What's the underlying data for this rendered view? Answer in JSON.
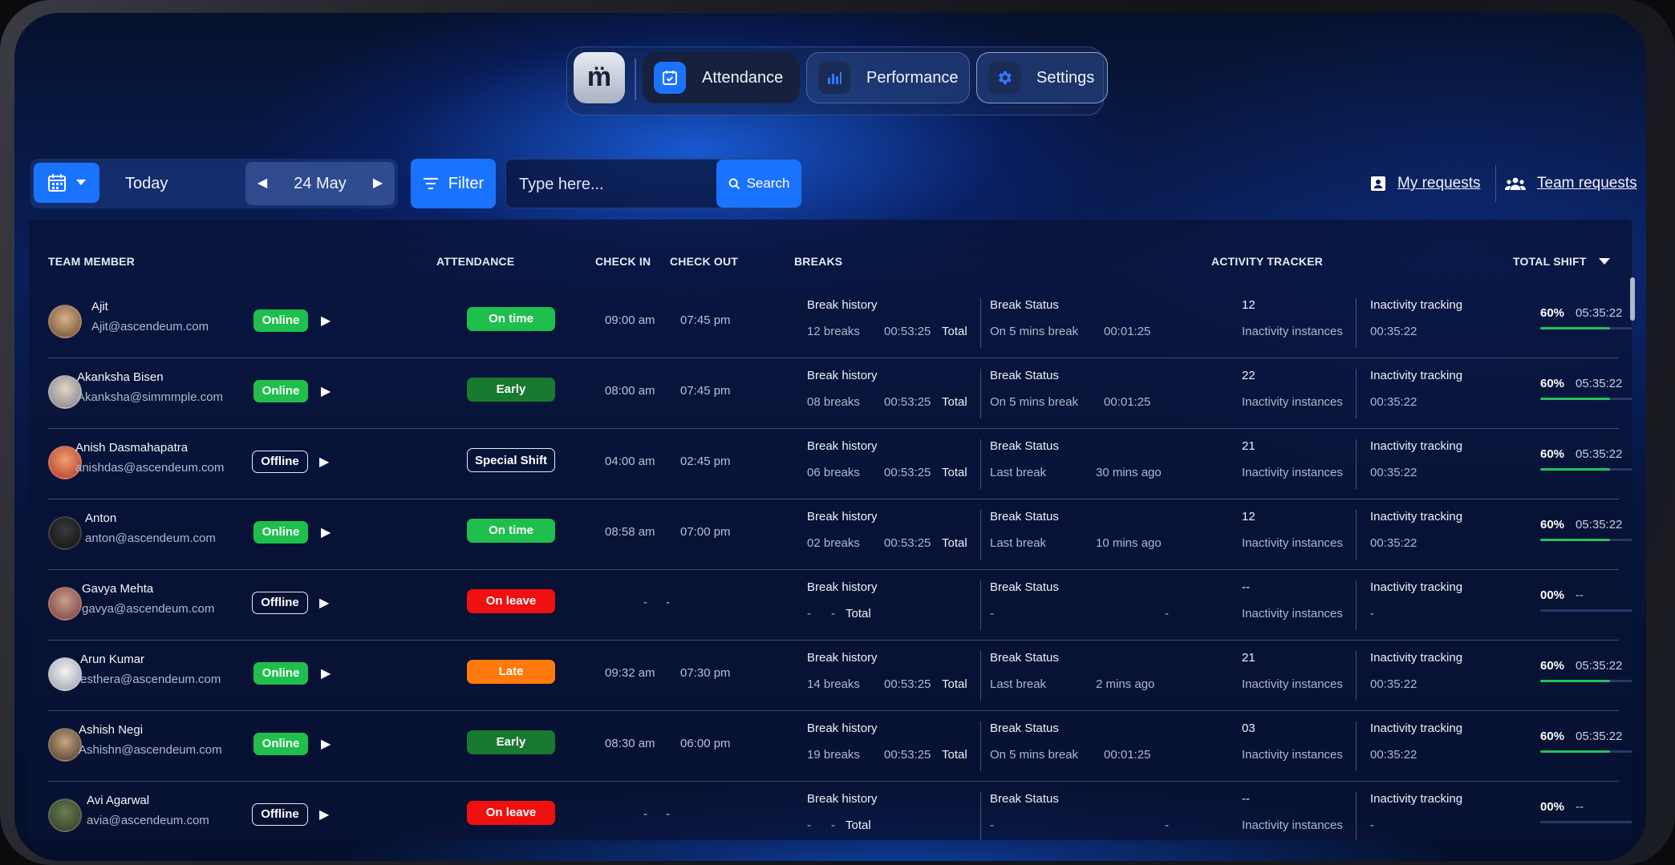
{
  "nav": {
    "logo_text": "m̈",
    "tabs": [
      {
        "label": "Attendance",
        "icon": "calendar-check-icon",
        "active": true
      },
      {
        "label": "Performance",
        "icon": "bar-chart-icon",
        "active": false
      },
      {
        "label": "Settings",
        "icon": "gear-icon",
        "active": false
      }
    ]
  },
  "toolbar": {
    "today_label": "Today",
    "date": "24 May",
    "filter_label": "Filter",
    "search_placeholder": "Type here...",
    "search_button": "Search",
    "my_requests": "My requests",
    "team_requests": "Team requests"
  },
  "table": {
    "headers": {
      "member": "TEAM MEMBER",
      "attendance": "ATTENDANCE",
      "check_in": "CHECK IN",
      "check_out": "CHECK OUT",
      "breaks": "BREAKS",
      "activity": "ACTIVITY TRACKER",
      "total_shift": "TOTAL SHIFT"
    },
    "labels": {
      "break_history": "Break history",
      "break_status": "Break Status",
      "inactivity_instances": "Inactivity instances",
      "inactivity_tracking": "Inactivity tracking",
      "total": "Total"
    },
    "rows": [
      {
        "name": "Ajit",
        "email": "Ajit@ascendeum.com",
        "presence": "Online",
        "attendance": "On time",
        "attendance_color": "#1fbf4d",
        "check_in": "09:00 am",
        "check_out": "07:45 pm",
        "break_count": "12 breaks",
        "break_time": "00:53:25",
        "break_status": "On 5 mins break",
        "break_status_time": "00:01:25",
        "inactivity_count": "12",
        "inactivity_time": "00:35:22",
        "pct": "60%",
        "shift": "05:35:22",
        "progress": 0.65
      },
      {
        "name": "Akanksha Bisen",
        "email": "Akanksha@simmmple.com",
        "presence": "Online",
        "attendance": "Early",
        "attendance_color": "#177a2f",
        "check_in": "08:00 am",
        "check_out": "07:45 pm",
        "break_count": "08 breaks",
        "break_time": "00:53:25",
        "break_status": "On 5 mins break",
        "break_status_time": "00:01:25",
        "inactivity_count": "22",
        "inactivity_time": "00:35:22",
        "pct": "60%",
        "shift": "05:35:22",
        "progress": 0.65
      },
      {
        "name": "Anish Dasmahapatra",
        "email": "anishdas@ascendeum.com",
        "presence": "Offline",
        "attendance": "Special Shift",
        "attendance_color": "outline",
        "check_in": "04:00 am",
        "check_out": "02:45 pm",
        "break_count": "06 breaks",
        "break_time": "00:53:25",
        "break_status": "Last break",
        "break_status_time": "30 mins ago",
        "inactivity_count": "21",
        "inactivity_time": "00:35:22",
        "pct": "60%",
        "shift": "05:35:22",
        "progress": 0.65
      },
      {
        "name": "Anton",
        "email": "anton@ascendeum.com",
        "presence": "Online",
        "attendance": "On time",
        "attendance_color": "#1fbf4d",
        "check_in": "08:58 am",
        "check_out": "07:00 pm",
        "break_count": "02 breaks",
        "break_time": "00:53:25",
        "break_status": "Last break",
        "break_status_time": "10 mins ago",
        "inactivity_count": "12",
        "inactivity_time": "00:35:22",
        "pct": "60%",
        "shift": "05:35:22",
        "progress": 0.65
      },
      {
        "name": "Gavya Mehta",
        "email": "gavya@ascendeum.com",
        "presence": "Offline",
        "attendance": "On leave",
        "attendance_color": "#f0100f",
        "check_in": "-",
        "check_out": "-",
        "break_count": "-",
        "break_time": "-",
        "break_status": "-",
        "break_status_time": "-",
        "inactivity_count": "--",
        "inactivity_time": "-",
        "pct": "00%",
        "shift": "--",
        "progress": 0
      },
      {
        "name": "Arun Kumar",
        "email": "esthera@ascendeum.com",
        "presence": "Online",
        "attendance": "Late",
        "attendance_color": "#ff7a0a",
        "check_in": "09:32 am",
        "check_out": "07:30 pm",
        "break_count": "14 breaks",
        "break_time": "00:53:25",
        "break_status": "Last break",
        "break_status_time": "2 mins ago",
        "inactivity_count": "21",
        "inactivity_time": "00:35:22",
        "pct": "60%",
        "shift": "05:35:22",
        "progress": 0.65
      },
      {
        "name": "Ashish Negi",
        "email": "Ashishn@ascendeum.com",
        "presence": "Online",
        "attendance": "Early",
        "attendance_color": "#177a2f",
        "check_in": "08:30 am",
        "check_out": "06:00 pm",
        "break_count": "19 breaks",
        "break_time": "00:53:25",
        "break_status": "On 5 mins break",
        "break_status_time": "00:01:25",
        "inactivity_count": "03",
        "inactivity_time": "00:35:22",
        "pct": "60%",
        "shift": "05:35:22",
        "progress": 0.65
      },
      {
        "name": "Avi Agarwal",
        "email": "avia@ascendeum.com",
        "presence": "Offline",
        "attendance": "On leave",
        "attendance_color": "#f0100f",
        "check_in": "-",
        "check_out": "-",
        "break_count": "-",
        "break_time": "-",
        "break_status": "-",
        "break_status_time": "-",
        "inactivity_count": "--",
        "inactivity_time": "-",
        "pct": "00%",
        "shift": "--",
        "progress": 0
      }
    ]
  }
}
